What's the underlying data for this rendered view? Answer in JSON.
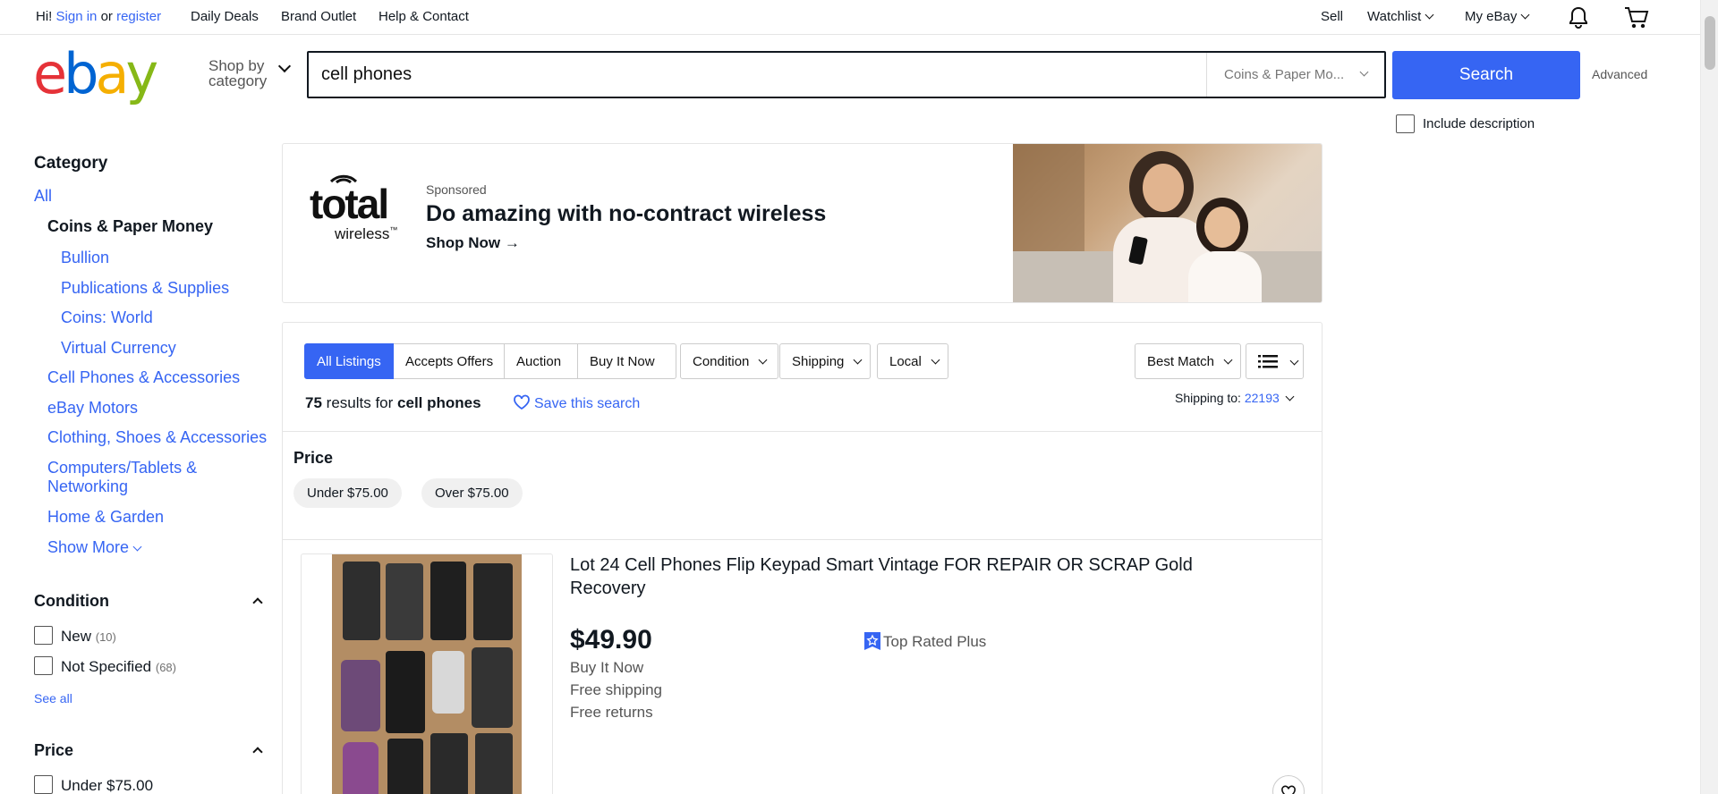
{
  "topbar": {
    "greeting": "Hi!",
    "sign_in": "Sign in",
    "or": "or",
    "register": "register",
    "links": [
      "Daily Deals",
      "Brand Outlet",
      "Help & Contact"
    ],
    "sell": "Sell",
    "watchlist": "Watchlist",
    "my_ebay": "My eBay",
    "icons": [
      "bell-icon",
      "cart-icon"
    ]
  },
  "header": {
    "logo_letters": [
      "e",
      "b",
      "a",
      "y"
    ],
    "logo_colors": [
      "#e53238",
      "#0064d2",
      "#f5af02",
      "#86b817"
    ],
    "shop_by_line1": "Shop by",
    "shop_by_line2": "category",
    "search_value": "cell phones",
    "category_select": "Coins & Paper Mo...",
    "search_button": "Search",
    "advanced": "Advanced",
    "include_description": "Include description"
  },
  "sidebar": {
    "category_heading": "Category",
    "all": "All",
    "current": "Coins & Paper Money",
    "subcategories": [
      "Bullion",
      "Publications & Supplies",
      "Coins: World",
      "Virtual Currency"
    ],
    "categories": [
      "Cell Phones & Accessories",
      "eBay Motors",
      "Clothing, Shoes & Accessories",
      "Computers/Tablets &",
      "Networking",
      "Home & Garden"
    ],
    "show_more": "Show More",
    "condition_heading": "Condition",
    "condition_options": [
      {
        "label": "New",
        "count": "(10)"
      },
      {
        "label": "Not Specified",
        "count": "(68)"
      }
    ],
    "see_all": "See all",
    "price_heading": "Price",
    "price_options": [
      "Under $75.00"
    ]
  },
  "banner": {
    "brand_line1": "total",
    "brand_line2": "wireless",
    "tm": "™",
    "sponsored": "Sponsored",
    "headline": "Do amazing with no-contract wireless",
    "cta": "Shop Now →"
  },
  "filters": {
    "tabs": [
      "All Listings",
      "Accepts Offers",
      "Auction",
      "Buy It Now"
    ],
    "dropdowns": [
      "Condition",
      "Shipping",
      "Local"
    ],
    "sort": "Best Match",
    "results_count": "75",
    "results_for": "results for",
    "query": "cell phones",
    "save_search": "Save this search",
    "shipping_to_label": "Shipping to:",
    "zip": "22193",
    "price_heading": "Price",
    "price_pills": [
      "Under $75.00",
      "Over $75.00"
    ]
  },
  "listing": {
    "title_line1": "Lot 24 Cell Phones Flip Keypad Smart Vintage FOR REPAIR OR SCRAP Gold",
    "title_line2": "Recovery",
    "price": "$49.90",
    "format": "Buy It Now",
    "shipping": "Free shipping",
    "returns": "Free returns",
    "badge": "Top Rated Plus"
  }
}
